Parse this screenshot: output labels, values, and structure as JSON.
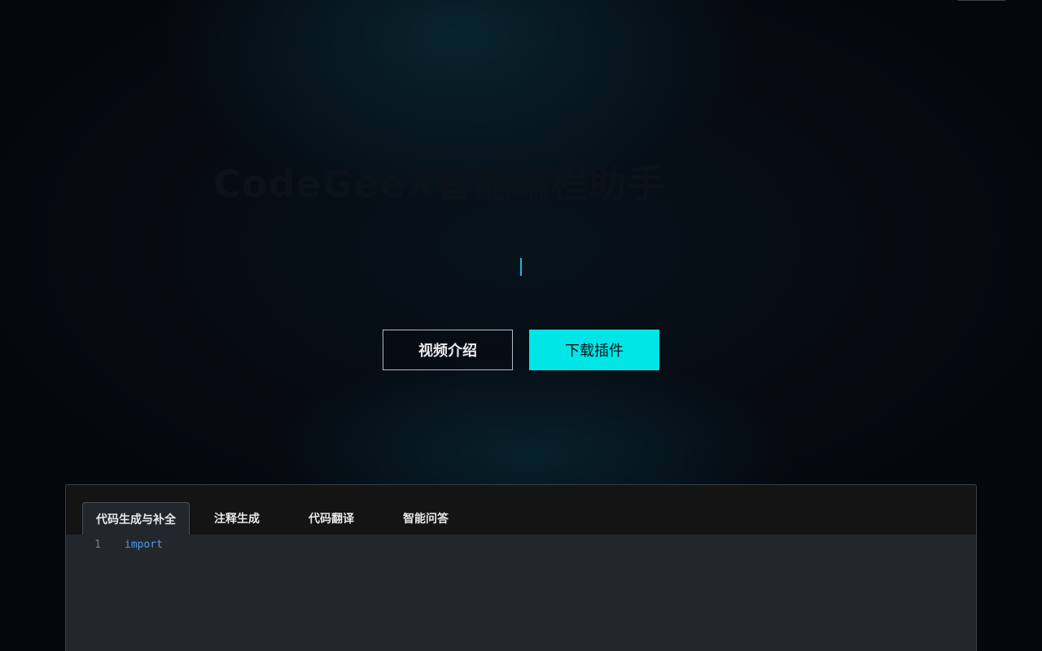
{
  "hero": {
    "title": "CodeGeeX智能编程助手"
  },
  "actions": {
    "video_label": "视频介绍",
    "download_label": "下载插件"
  },
  "demo": {
    "tabs": [
      {
        "label": "代码生成与补全",
        "active": true
      },
      {
        "label": "注释生成",
        "active": false
      },
      {
        "label": "代码翻译",
        "active": false
      },
      {
        "label": "智能问答",
        "active": false
      }
    ],
    "code_lines": [
      {
        "number": "1",
        "text": "import"
      }
    ]
  },
  "colors": {
    "accent": "#00e5e6",
    "background": "#05070e",
    "caret": "#1fb7d6",
    "keyword": "#4d9ee8"
  }
}
